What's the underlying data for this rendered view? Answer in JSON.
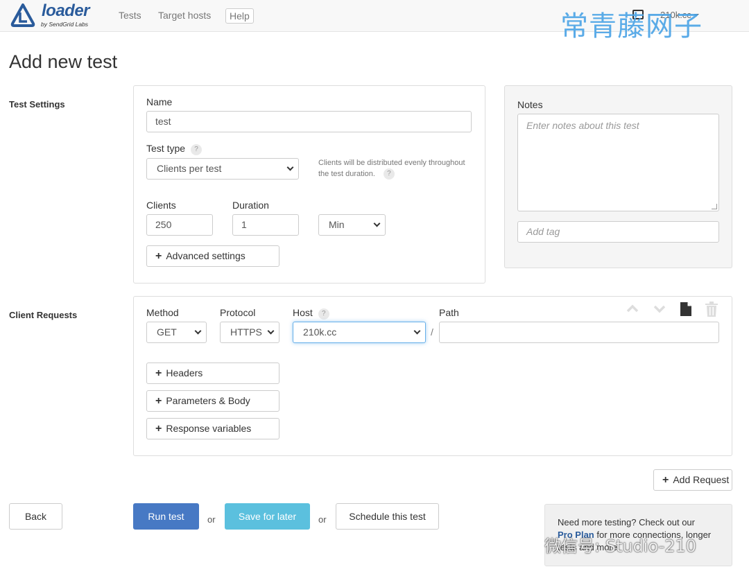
{
  "navbar": {
    "logo_text": "loader",
    "logo_sub": "by SendGrid Labs",
    "links": [
      "Tests",
      "Target hosts",
      "Help"
    ],
    "user_label": "210k.cc"
  },
  "watermark": {
    "top": "常青藤网子",
    "bottom": "微信号: Studio-210"
  },
  "page_title": "Add new test",
  "test_settings": {
    "section_label": "Test Settings",
    "name_label": "Name",
    "name_value": "test",
    "test_type_label": "Test type",
    "hint_icon": "question-circle-icon",
    "test_type_value": "Clients per test",
    "test_type_hint": "Clients will be distributed evenly throughout the test duration.",
    "clients_label": "Clients",
    "clients_value": "250",
    "duration_label": "Duration",
    "duration_value": "1",
    "duration_unit": "Min",
    "advanced_label": "Advanced settings"
  },
  "notes": {
    "label": "Notes",
    "placeholder": "Enter notes about this test",
    "tag_placeholder": "Add tag"
  },
  "client_requests": {
    "section_label": "Client Requests",
    "method_label": "Method",
    "method_value": "GET",
    "protocol_label": "Protocol",
    "protocol_value": "HTTPS",
    "host_label": "Host",
    "host_value": "210k.cc",
    "path_label": "Path",
    "path_separator": "/",
    "path_value": "",
    "headers_label": "Headers",
    "params_label": "Parameters & Body",
    "response_vars_label": "Response variables",
    "add_request_label": "Add Request"
  },
  "actions": {
    "back": "Back",
    "run": "Run test",
    "or": "or",
    "save": "Save for later",
    "schedule": "Schedule this test"
  },
  "promo": {
    "text_before": "Need more testing? Check out our",
    "link": "Pro Plan",
    "text_after": "for more connections, longer tests and more."
  },
  "colors": {
    "primary": "#4779c4",
    "info": "#5bc0de",
    "brand": "#2a5b9b"
  }
}
